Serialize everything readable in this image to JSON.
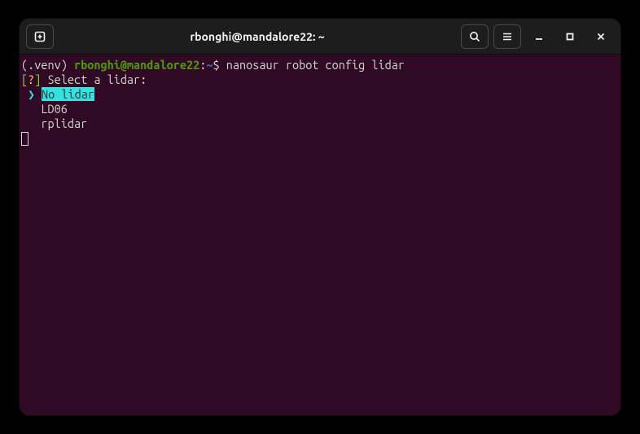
{
  "window": {
    "title": "rbonghi@mandalore22: ~"
  },
  "prompt": {
    "venv": "(.venv) ",
    "user_host": "rbonghi@mandalore22",
    "colon": ":",
    "path": "~",
    "dollar": "$ ",
    "command": "nanosaur robot config lidar"
  },
  "question": {
    "open_bracket": "[",
    "mark": "?",
    "close_bracket": "]",
    "text": " Select a lidar:"
  },
  "options": {
    "pointer": " ❯ ",
    "selected": "No lidar",
    "items": [
      "LD06",
      "rplidar"
    ],
    "indent": "   "
  }
}
